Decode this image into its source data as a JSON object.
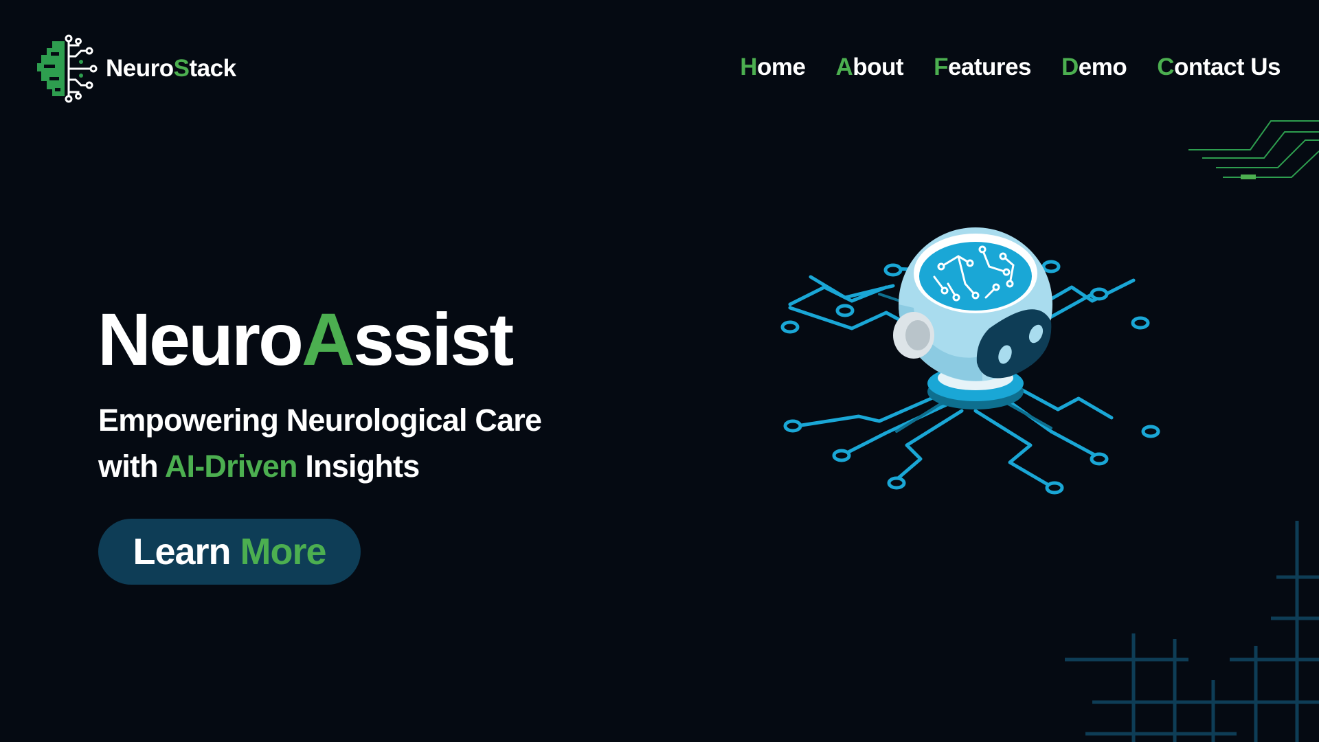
{
  "brand": {
    "name_part1": "Neuro",
    "name_accent": "S",
    "name_part2": "tack",
    "logo_icon": "brain-circuit-icon"
  },
  "nav": {
    "items": [
      {
        "first": "H",
        "rest": "ome"
      },
      {
        "first": "A",
        "rest": "bout"
      },
      {
        "first": "F",
        "rest": "eatures"
      },
      {
        "first": "D",
        "rest": "emo"
      },
      {
        "first": "C",
        "rest": "ontact Us"
      }
    ]
  },
  "hero": {
    "title_part1": "Neuro",
    "title_accent": "A",
    "title_part2": "ssist",
    "subtitle_line1": "Empowering Neurological Care",
    "subtitle_line2_prefix": "with ",
    "subtitle_line2_accent": "AI-Driven",
    "subtitle_line2_suffix": " Insights",
    "cta_word1": "Learn",
    "cta_word2": "More",
    "illustration_icon": "robot-brain-circuit-icon"
  },
  "colors": {
    "background": "#050a12",
    "accent_green": "#4caf50",
    "button_bg": "#0e3d56",
    "circuit_blue": "#1aa7d6",
    "text": "#ffffff"
  }
}
